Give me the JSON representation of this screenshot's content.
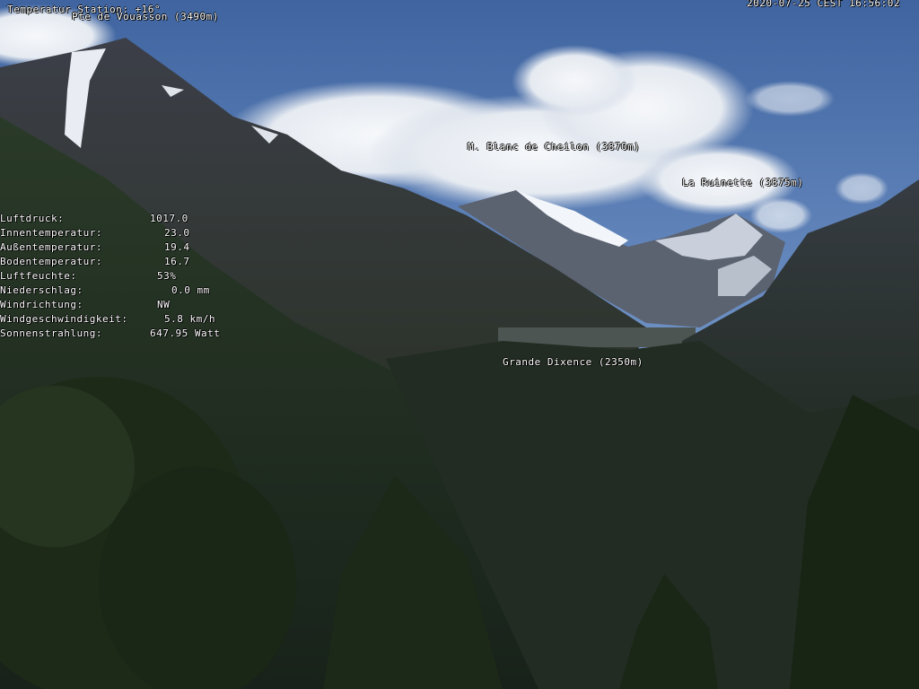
{
  "overlay": {
    "station_temp": "Temperatur Station: +16°",
    "timestamp": "2020-07-25 CEST 16:56:02"
  },
  "peaks": {
    "vouasson": "Pte de Vouasson (3490m)",
    "cheilon": "M. Blanc de Cheilon (3870m)",
    "ruinette": "La Ruinette (3875m)",
    "dixence": "Grande Dixence (2350m)"
  },
  "weather": [
    {
      "label": "Luftdruck:",
      "value": "1017.0"
    },
    {
      "label": "Innentemperatur:",
      "value": "23.0"
    },
    {
      "label": "Außentemperatur:",
      "value": "19.4"
    },
    {
      "label": "Bodentemperatur:",
      "value": "16.7"
    },
    {
      "label": "Luftfeuchte:",
      "value": "53%"
    },
    {
      "label": "Niederschlag:",
      "value": "0.0 mm"
    },
    {
      "label": "Windrichtung:",
      "value": "NW"
    },
    {
      "label": "Windgeschwindigkeit:",
      "value": "5.8 km/h"
    },
    {
      "label": "Sonnenstrahlung:",
      "value": "647.95 Watt"
    }
  ]
}
